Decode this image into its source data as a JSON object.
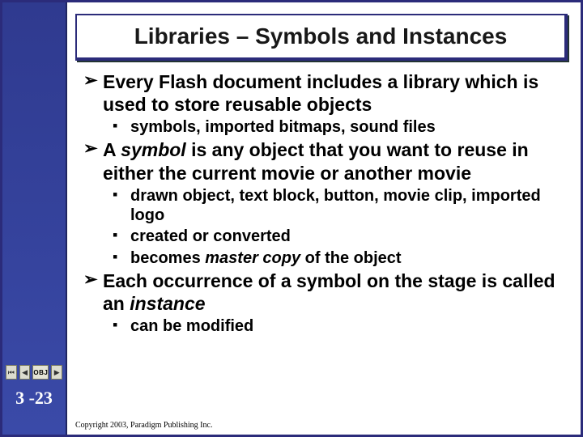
{
  "title": "Libraries – Symbols and Instances",
  "bullets": {
    "b1": "Every Flash document includes a library which is used to store reusable objects",
    "b1a": "symbols, imported bitmaps, sound files",
    "b2_pre": "A ",
    "b2_em": "symbol",
    "b2_post": " is any object that you want to reuse in either the current movie or another movie",
    "b2a": "drawn object, text block, button, movie clip, imported logo",
    "b2b": "created or converted",
    "b2c_pre": "becomes ",
    "b2c_em": "master copy",
    "b2c_post": " of the object",
    "b3_pre": "Each occurrence of a symbol on the stage is called an ",
    "b3_em": "instance",
    "b3a": "can be modified"
  },
  "nav": {
    "obj_label": "OBJ",
    "first_glyph": "⏮",
    "prev_glyph": "◀",
    "next_glyph": "▶"
  },
  "slide_number": "3 -23",
  "copyright": "Copyright 2003, Paradigm Publishing Inc."
}
